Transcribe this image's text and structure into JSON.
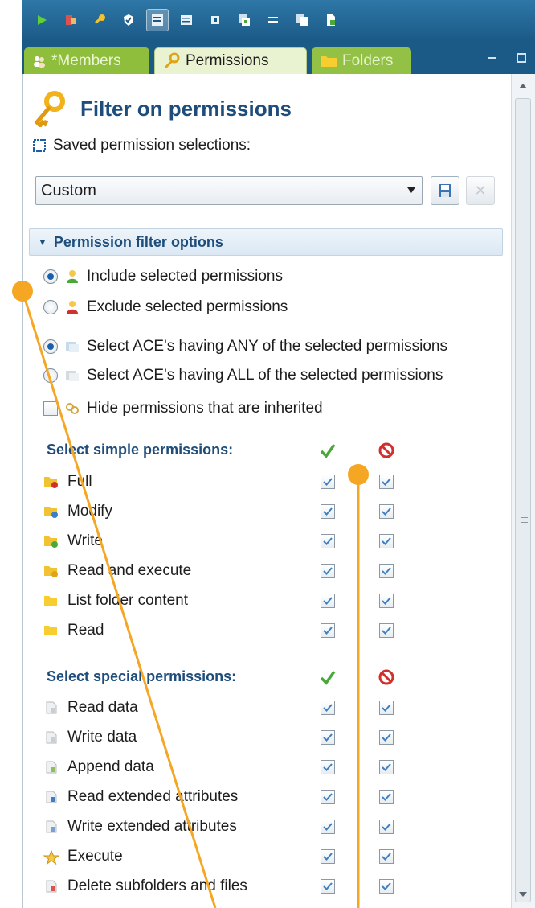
{
  "toolbar": {
    "icons": [
      "play-icon",
      "tools-icon",
      "key-icon",
      "shield-check-icon",
      "grid-active-icon",
      "grid-icon",
      "square-icon",
      "copy-icon",
      "list-icon",
      "duplicate-icon",
      "document-icon"
    ]
  },
  "tabs": [
    {
      "label": "*Members",
      "icon": "users-icon"
    },
    {
      "label": "Permissions",
      "icon": "key-icon"
    },
    {
      "label": "Folders",
      "icon": "folder-icon"
    }
  ],
  "panel": {
    "title": "Filter on permissions",
    "saved_label": "Saved permission selections:",
    "dropdown_value": "Custom"
  },
  "filter_options": {
    "header": "Permission filter options",
    "include": "Include selected permissions",
    "exclude": "Exclude selected permissions",
    "any": "Select ACE's having ANY of the selected permissions",
    "all": "Select ACE's having ALL of the selected permissions",
    "hide_inherited": "Hide permissions that are inherited"
  },
  "simple": {
    "title": "Select simple permissions:",
    "items": [
      "Full",
      "Modify",
      "Write",
      "Read and execute",
      "List folder content",
      "Read"
    ]
  },
  "special": {
    "title": "Select special permissions:",
    "items": [
      "Read data",
      "Write data",
      "Append data",
      "Read extended attributes",
      "Write extended attributes",
      "Execute",
      "Delete subfolders and files"
    ]
  },
  "colors": {
    "toolbar": "#1b5a87",
    "heading": "#1e4d7b",
    "accent_orange": "#f5a623",
    "allow_green": "#4aa83a",
    "deny_red": "#d0302e"
  }
}
